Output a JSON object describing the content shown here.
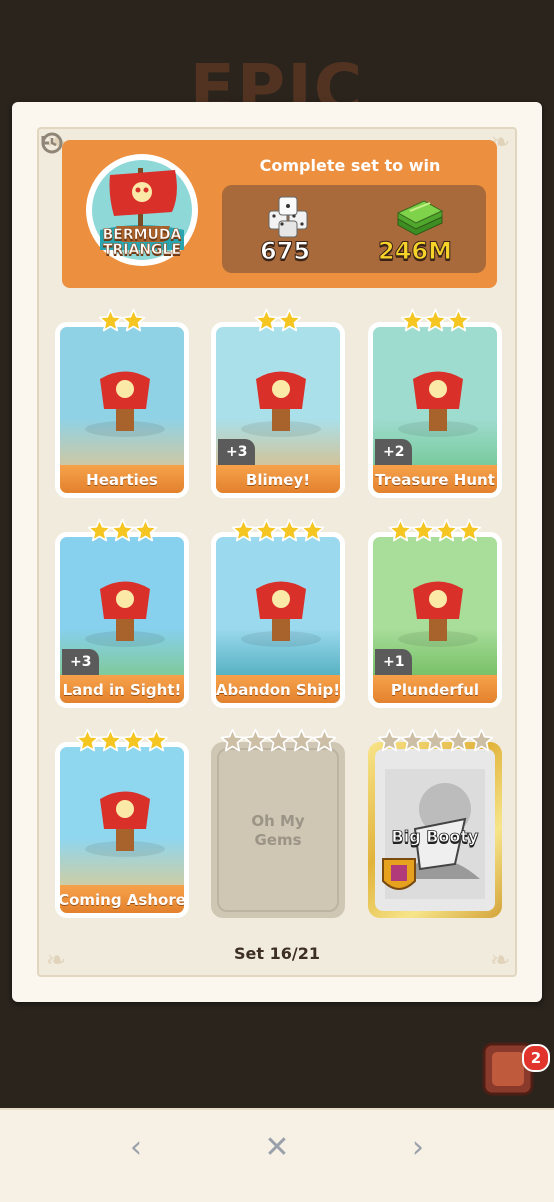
{
  "background_title": "EPIC",
  "set": {
    "name_line1": "BERMUDA",
    "name_line2": "TRIANGLE",
    "complete_label": "Complete set to win",
    "reward_dice": "675",
    "reward_cash": "246M",
    "progress": "Set 16/21"
  },
  "cards": [
    {
      "name": "Hearties",
      "stars": 2,
      "extra": "",
      "state": "collected"
    },
    {
      "name": "Blimey!",
      "stars": 2,
      "extra": "+3",
      "state": "collected"
    },
    {
      "name": "Treasure Hunt",
      "stars": 3,
      "extra": "+2",
      "state": "collected"
    },
    {
      "name": "Land in Sight!",
      "stars": 3,
      "extra": "+3",
      "state": "collected"
    },
    {
      "name": "Abandon Ship!",
      "stars": 4,
      "extra": "",
      "state": "collected"
    },
    {
      "name": "Plunderful",
      "stars": 4,
      "extra": "+1",
      "state": "collected"
    },
    {
      "name": "Coming Ashore",
      "stars": 4,
      "extra": "",
      "state": "collected"
    },
    {
      "name_line1": "Oh My",
      "name_line2": "Gems",
      "stars": 5,
      "state": "missing"
    },
    {
      "name": "Big Booty",
      "stars": 5,
      "state": "gold-missing"
    }
  ],
  "nav": {
    "prev": "‹",
    "close": "✕",
    "next": "›"
  },
  "dice_badge": "2",
  "colors": {
    "header_orange": "#ec8f3f",
    "label_orange": "#e98a33",
    "star_gold": "#f5c521",
    "star_gray": "#cdbfa6",
    "reward_cash": "#f8d32a"
  }
}
